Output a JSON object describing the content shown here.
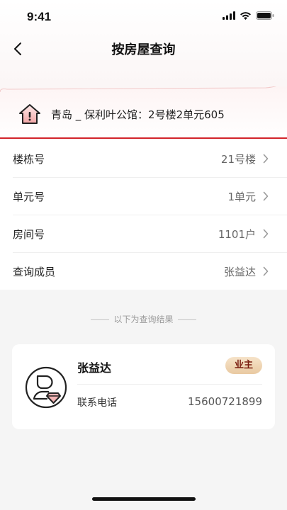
{
  "status_bar": {
    "time": "9:41"
  },
  "nav": {
    "title": "按房屋查询"
  },
  "address": {
    "text": "青岛 _ 保利叶公馆：2号楼2单元605"
  },
  "form": {
    "rows": [
      {
        "label": "楼栋号",
        "value": "21号楼"
      },
      {
        "label": "单元号",
        "value": "1单元"
      },
      {
        "label": "房间号",
        "value": "1101户"
      },
      {
        "label": "查询成员",
        "value": "张益达"
      }
    ]
  },
  "results": {
    "divider_text": "以下为查询结果",
    "member": {
      "name": "张益达",
      "role": "业主",
      "phone_label": "联系电话",
      "phone": "15600721899"
    }
  },
  "colors": {
    "accent": "#d2232a",
    "badge_text": "#7a1d0f",
    "badge_bg": "#f0d7b6"
  },
  "icons": [
    "chevron-left-icon",
    "house-icon",
    "chevron-right-icon",
    "user-vip-icon",
    "signal-icon",
    "wifi-icon",
    "battery-icon"
  ]
}
